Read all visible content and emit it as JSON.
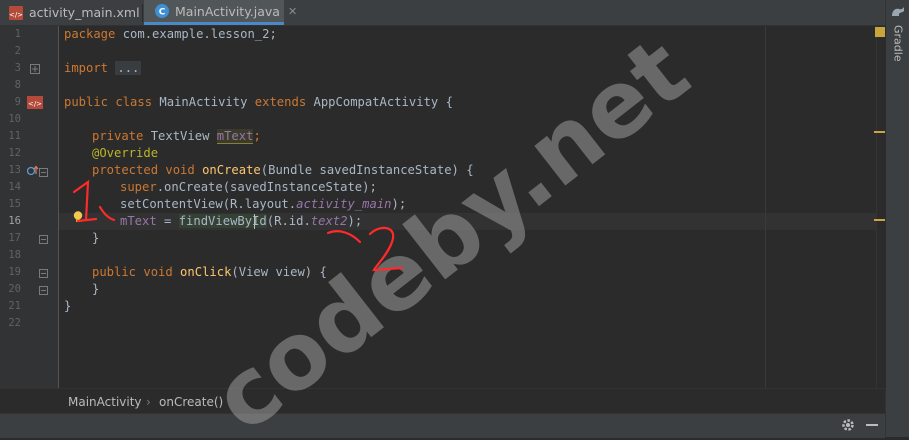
{
  "tabs": [
    {
      "label": "activity_main.xml",
      "icon": "xml-file-icon",
      "active": false
    },
    {
      "label": "MainActivity.java",
      "icon": "java-class-icon",
      "active": true
    }
  ],
  "right_panel": {
    "gradle_label": "Gradle"
  },
  "line_numbers": [
    "1",
    "2",
    "3",
    "8",
    "9",
    "10",
    "11",
    "12",
    "13",
    "14",
    "15",
    "16",
    "17",
    "18",
    "19",
    "20",
    "21",
    "22"
  ],
  "code": {
    "l1": {
      "kw": "package",
      "rest": " com.example.lesson_2;"
    },
    "l3": {
      "kw": "import",
      "fold": "..."
    },
    "l9": {
      "kw": "public class",
      "cls": " MainActivity ",
      "kw2": "extends",
      "rest": " AppCompatActivity {"
    },
    "l11": {
      "kw": "private",
      "type": " TextView ",
      "field": "mText",
      "end": ";"
    },
    "l12": {
      "ann": "@Override"
    },
    "l13": {
      "kw": "protected void",
      "fn": " onCreate",
      "rest": "(Bundle savedInstanceState) {"
    },
    "l14": {
      "kw": "super",
      "rest": ".onCreate(savedInstanceState);"
    },
    "l15": {
      "pre": "setContentView(R.layout.",
      "ital": "activity_main",
      "end": ");"
    },
    "l16": {
      "field": "mText",
      "mid": " = ",
      "call": "findViewById",
      "pre": "(R.id.",
      "ital": "text2",
      "end": ");"
    },
    "l17": {
      "text": "}"
    },
    "l19": {
      "kw": "public void",
      "fn": " onClick",
      "rest": "(View view) {"
    },
    "l20": {
      "text": "}"
    },
    "l21": {
      "text": "}"
    }
  },
  "breadcrumb": {
    "class": "MainActivity",
    "method": "onCreate()",
    "sep": "›"
  },
  "annotations": {
    "one": "1",
    "two": "2"
  },
  "watermark": "codeby.net",
  "colors": {
    "keyword": "#cc7832",
    "annotation": "#bbb529",
    "field": "#9876aa",
    "method": "#ffc66d",
    "text": "#a9b7c6",
    "background": "#2b2b2b",
    "red_marker": "#ff2a2a"
  }
}
